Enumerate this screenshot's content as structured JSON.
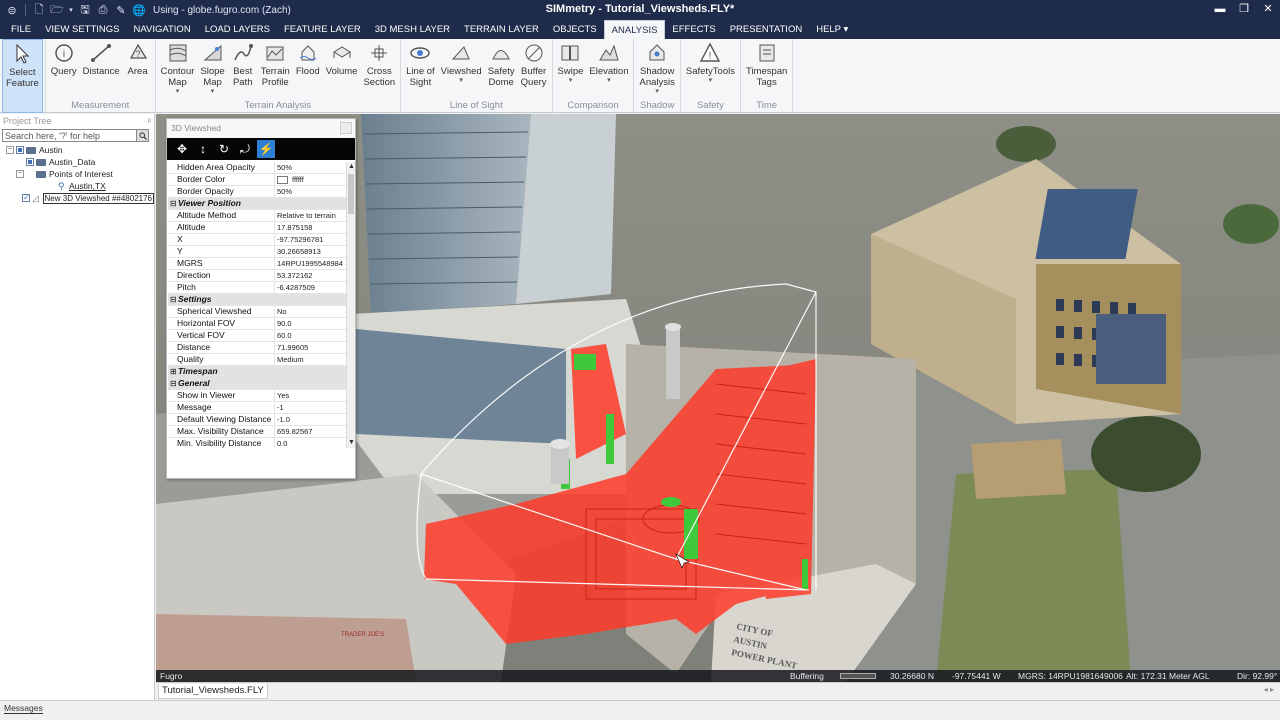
{
  "titlebar": {
    "using_text": "Using - globe.fugro.com (Zach)",
    "app_title": "SIMmetry - Tutorial_Viewsheds.FLY*"
  },
  "menu": {
    "tabs": [
      "FILE",
      "VIEW SETTINGS",
      "NAVIGATION",
      "LOAD LAYERS",
      "FEATURE LAYER",
      "3D MESH LAYER",
      "TERRAIN LAYER",
      "OBJECTS",
      "ANALYSIS",
      "EFFECTS",
      "PRESENTATION",
      "HELP ▾"
    ],
    "active": "ANALYSIS"
  },
  "ribbon": {
    "groups": [
      {
        "label": "",
        "buttons": [
          {
            "label": "Select\nFeature",
            "icon": "cursor-icon",
            "selected": true
          }
        ]
      },
      {
        "label": "Measurement",
        "buttons": [
          {
            "label": "Query",
            "icon": "query-icon"
          },
          {
            "label": "Distance",
            "icon": "distance-icon"
          },
          {
            "label": "Area",
            "icon": "area-icon"
          }
        ]
      },
      {
        "label": "Terrain Analysis",
        "buttons": [
          {
            "label": "Contour\nMap",
            "icon": "contour-icon",
            "dd": true
          },
          {
            "label": "Slope\nMap",
            "icon": "slope-icon",
            "dd": true
          },
          {
            "label": "Best\nPath",
            "icon": "path-icon"
          },
          {
            "label": "Terrain\nProfile",
            "icon": "profile-icon"
          },
          {
            "label": "Flood",
            "icon": "flood-icon"
          },
          {
            "label": "Volume",
            "icon": "volume-icon"
          },
          {
            "label": "Cross\nSection",
            "icon": "cross-section-icon"
          }
        ]
      },
      {
        "label": "Line of Sight",
        "buttons": [
          {
            "label": "Line of\nSight",
            "icon": "eye-icon"
          },
          {
            "label": "Viewshed",
            "icon": "viewshed-icon",
            "dd": true
          },
          {
            "label": "Safety\nDome",
            "icon": "dome-icon"
          },
          {
            "label": "Buffer\nQuery",
            "icon": "buffer-icon"
          }
        ]
      },
      {
        "label": "Comparison",
        "buttons": [
          {
            "label": "Swipe",
            "icon": "swipe-icon",
            "dd": true
          },
          {
            "label": "Elevation",
            "icon": "elevation-icon",
            "dd": true
          }
        ]
      },
      {
        "label": "Shadow",
        "buttons": [
          {
            "label": "Shadow\nAnalysis",
            "icon": "house-icon",
            "dd": true
          }
        ]
      },
      {
        "label": "Safety",
        "buttons": [
          {
            "label": "SafetyTools",
            "icon": "warning-icon",
            "dd": true
          }
        ]
      },
      {
        "label": "Time",
        "buttons": [
          {
            "label": "Timespan\nTags",
            "icon": "timespan-icon"
          }
        ]
      }
    ]
  },
  "project_tree": {
    "title": "Project Tree",
    "pin": "ᵖ",
    "search_placeholder": "Search here, '?' for help",
    "nodes": {
      "austin": "Austin",
      "austin_data": "Austin_Data",
      "poi": "Points of Interest",
      "austin_tx": "Austin,TX",
      "viewshed": "New 3D Viewshed ##4802176"
    }
  },
  "viewshed_panel": {
    "title": "3D Viewshed",
    "rows": [
      {
        "name": "Hidden Area Opacity",
        "value": "50%"
      },
      {
        "name": "Border Color",
        "value": "ffffff",
        "swatch": true
      },
      {
        "name": "Border Opacity",
        "value": "50%"
      },
      {
        "category": "Viewer Position",
        "toggle": "⊟"
      },
      {
        "name": "Altitude Method",
        "value": "Relative to terrain"
      },
      {
        "name": "Altitude",
        "value": "17.875158"
      },
      {
        "name": "X",
        "value": "-97.75296781"
      },
      {
        "name": "Y",
        "value": "30.26658913"
      },
      {
        "name": "MGRS",
        "value": "14RPU1995548984"
      },
      {
        "name": "Direction",
        "value": "53.372162"
      },
      {
        "name": "Pitch",
        "value": "-6.4287509"
      },
      {
        "category": "Settings",
        "toggle": "⊟"
      },
      {
        "name": "Spherical Viewshed",
        "value": "No"
      },
      {
        "name": "Horizontal FOV",
        "value": "90.0"
      },
      {
        "name": "Vertical FOV",
        "value": "60.0"
      },
      {
        "name": "Distance",
        "value": "71.99605"
      },
      {
        "name": "Quality",
        "value": "Medium"
      },
      {
        "category": "Timespan",
        "toggle": "⊞"
      },
      {
        "category": "General",
        "toggle": "⊟"
      },
      {
        "name": "Show in Viewer",
        "value": "Yes"
      },
      {
        "name": "Message",
        "value": "-1"
      },
      {
        "name": "Default Viewing Distance",
        "value": "-1.0"
      },
      {
        "name": "Max. Visibility Distance",
        "value": "659.82567"
      },
      {
        "name": "Min. Visibility Distance",
        "value": "0.0"
      }
    ]
  },
  "viewer_status": {
    "brand": "Fugro",
    "buffering": "Buffering",
    "lat": "30.26680 N",
    "lon": "-97.75441 W",
    "mgrs": "MGRS: 14RPU1981649006",
    "alt": "Alt: 172.31 Meter AGL",
    "dir": "Dir: 92.99°"
  },
  "scene_text": {
    "sign_line1": "CITY OF",
    "sign_line2": "AUSTIN",
    "sign_line3": "POWER PLANT",
    "trader": "TRADER JOE'S"
  },
  "doc_tab": "Tutorial_Viewsheds.FLY",
  "doc_nav": "◂ ▸",
  "messages_tab": "Messages",
  "colors": {
    "title_bg": "#1f2b4a",
    "viewshed_hidden": "#ff3b2a",
    "viewshed_visible": "#3ec93a",
    "selection_blue": "#2d7fd4"
  }
}
